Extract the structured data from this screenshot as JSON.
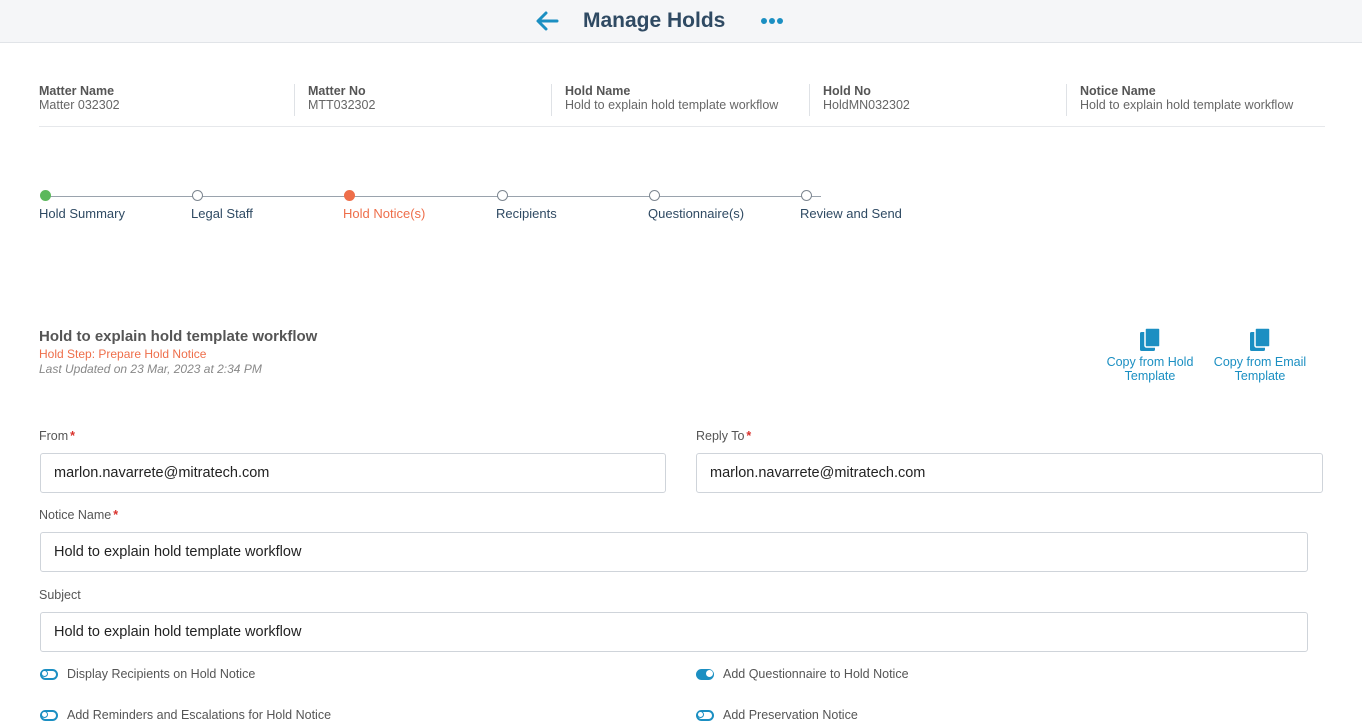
{
  "header": {
    "title": "Manage Holds",
    "back_icon": "arrow-left-icon",
    "more_icon": "more-horizontal-icon"
  },
  "info": [
    {
      "label": "Matter Name",
      "value": "Matter 032302"
    },
    {
      "label": "Matter No",
      "value": "MTT032302"
    },
    {
      "label": "Hold Name",
      "value": "Hold to explain hold template workflow"
    },
    {
      "label": "Hold No",
      "value": "HoldMN032302"
    },
    {
      "label": "Notice Name",
      "value": "Hold to explain hold template workflow"
    }
  ],
  "stepper": {
    "steps": [
      {
        "label": "Hold Summary",
        "state": "done"
      },
      {
        "label": "Legal Staff",
        "state": "pending"
      },
      {
        "label": "Hold Notice(s)",
        "state": "active"
      },
      {
        "label": "Recipients",
        "state": "pending"
      },
      {
        "label": "Questionnaire(s)",
        "state": "pending"
      },
      {
        "label": "Review and Send",
        "state": "pending"
      }
    ],
    "colors": {
      "done": "#5cb85c",
      "active": "#ee6e4a",
      "pending": "#7d8690"
    }
  },
  "notice": {
    "title": "Hold to explain hold template workflow",
    "step": "Hold Step: Prepare Hold Notice",
    "updated": "Last Updated on 23 Mar, 2023 at 2:34 PM"
  },
  "copy_actions": {
    "hold_template": {
      "line1": "Copy from Hold",
      "line2": "Template",
      "icon": "copy-icon"
    },
    "email_template": {
      "line1": "Copy from Email",
      "line2": "Template",
      "icon": "copy-icon"
    }
  },
  "form": {
    "from": {
      "label": "From",
      "value": "marlon.navarrete@mitratech.com",
      "required": "*"
    },
    "reply_to": {
      "label": "Reply To",
      "value": "marlon.navarrete@mitratech.com",
      "required": "*"
    },
    "notice_name": {
      "label": "Notice Name",
      "value": "Hold to explain hold template workflow",
      "required": "*"
    },
    "subject": {
      "label": "Subject",
      "value": "Hold to explain hold template workflow"
    }
  },
  "toggles": {
    "display_recipients": {
      "label": "Display Recipients on Hold Notice",
      "on": false
    },
    "add_questionnaire": {
      "label": "Add Questionnaire to Hold Notice",
      "on": true
    },
    "add_reminders": {
      "label": "Add Reminders and Escalations for Hold Notice",
      "on": false
    },
    "add_preservation": {
      "label": "Add Preservation Notice",
      "on": false
    }
  },
  "accent_color": "#1b8fc2",
  "title_color": "#2f4a63"
}
